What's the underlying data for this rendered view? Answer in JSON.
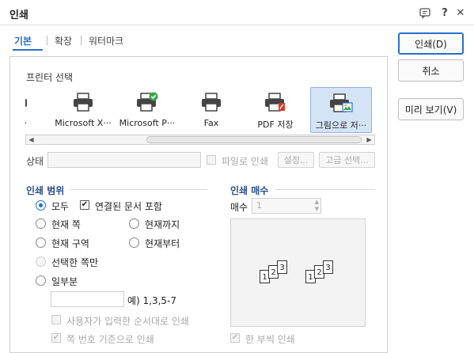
{
  "window": {
    "title": "인쇄",
    "help_icon_label": "?",
    "close_icon_label": "✕",
    "chat_icon_label": "▤"
  },
  "tabs": [
    {
      "label": "기본",
      "active": true
    },
    {
      "label": "확장",
      "active": false
    },
    {
      "label": "워터마크",
      "active": false
    }
  ],
  "actions": {
    "print_label": "인쇄(D)",
    "cancel_label": "취소",
    "preview_label": "미리 보기(V)"
  },
  "printer_select": {
    "label": "프린터 선택",
    "printers": [
      {
        "name": "e f···",
        "icon": "printer-icon"
      },
      {
        "name": "Microsoft X···",
        "icon": "printer-icon"
      },
      {
        "name": "Microsoft P···",
        "icon": "printer-default-icon"
      },
      {
        "name": "Fax",
        "icon": "printer-icon"
      },
      {
        "name": "PDF 저장",
        "icon": "pdf-printer-icon"
      },
      {
        "name": "그림으로 저···",
        "icon": "image-printer-icon",
        "selected": true
      }
    ]
  },
  "status": {
    "label": "상태",
    "value": "",
    "print_to_file_label": "파일로 인쇄",
    "settings_label": "설정...",
    "advanced_label": "고급 선택..."
  },
  "print_range": {
    "title": "인쇄 범위",
    "all_label": "모두",
    "linked_docs_label": "연결된 문서 포함",
    "current_page_label": "현재 쪽",
    "to_current_label": "현재까지",
    "current_section_label": "현재 구역",
    "from_current_label": "현재부터",
    "selected_pages_label": "선택한 쪽만",
    "partial_label": "일부분",
    "partial_value": "",
    "partial_example": "예) 1,3,5-7",
    "user_order_label": "사용자가 입력한 순서대로 인쇄",
    "page_number_basis_label": "쪽 번호 기준으로 인쇄"
  },
  "copies": {
    "title": "인쇄 매수",
    "count_label": "매수",
    "count_value": "1",
    "collate_label": "한 부씩 인쇄",
    "pages": [
      "1",
      "2",
      "3"
    ]
  },
  "colors": {
    "accent": "#2a6fc9",
    "section_title": "#2a4f8a",
    "selected_bg": "#d5e3f7"
  }
}
